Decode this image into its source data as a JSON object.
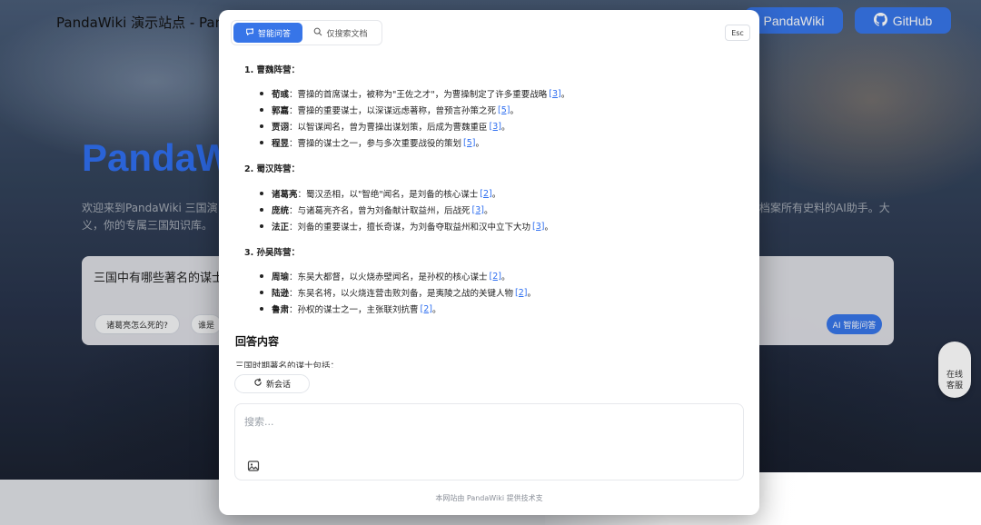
{
  "background": {
    "site_title": "PandaWiki 演示站点 - Pan",
    "buttons": {
      "pandawiki": "PandaWiki",
      "github": "GitHub"
    },
    "hero_title": "PandaW",
    "desc_left": "欢迎来到PandaWiki 三国演义，你的专属三国知识库。",
    "desc_right": "档案所有史料的AI助手。大",
    "search_text": "三国中有哪些著名的谋士",
    "chips": [
      "诸葛亮怎么死的?",
      "谁是"
    ],
    "ai_button": "AI 智能问答",
    "online_service": [
      "在线",
      "客服"
    ]
  },
  "modal": {
    "tabs": [
      {
        "label": "智能问答",
        "active": true,
        "icon": "chat-sparkle-icon"
      },
      {
        "label": "仅搜索文档",
        "active": false,
        "icon": "search-icon"
      }
    ],
    "esc_label": "Esc",
    "sections": [
      {
        "heading": "1. 曹魏阵营：",
        "items": [
          {
            "name": "荀彧",
            "text": "：曹操的首席谋士，被称为\"王佐之才\"，为曹操制定了许多重要战略 ",
            "cite": "[3]",
            "end": "。"
          },
          {
            "name": "郭嘉",
            "text": "：曹操的重要谋士，以深谋远虑著称，曾预言孙策之死 ",
            "cite": "[5]",
            "end": "。"
          },
          {
            "name": "贾诩",
            "text": "：以智谋闻名，曾为曹操出谋划策，后成为曹魏重臣 ",
            "cite": "[3]",
            "end": "。"
          },
          {
            "name": "程昱",
            "text": "：曹操的谋士之一，参与多次重要战役的策划 ",
            "cite": "[5]",
            "end": "。"
          }
        ]
      },
      {
        "heading": "2. 蜀汉阵营：",
        "items": [
          {
            "name": "诸葛亮",
            "text": "：蜀汉丞相，以\"智绝\"闻名，是刘备的核心谋士 ",
            "cite": "[2]",
            "end": "。"
          },
          {
            "name": "庞统",
            "text": "：与诸葛亮齐名，曾为刘备献计取益州，后战死 ",
            "cite": "[3]",
            "end": "。"
          },
          {
            "name": "法正",
            "text": "：刘备的重要谋士，擅长奇谋，为刘备夺取益州和汉中立下大功 ",
            "cite": "[3]",
            "end": "。"
          }
        ]
      },
      {
        "heading": "3. 孙吴阵营：",
        "items": [
          {
            "name": "周瑜",
            "text": "：东吴大都督，以火烧赤壁闻名，是孙权的核心谋士 ",
            "cite": "[2]",
            "end": "。"
          },
          {
            "name": "陆逊",
            "text": "：东吴名将，以火烧连营击败刘备，是夷陵之战的关键人物 ",
            "cite": "[2]",
            "end": "。"
          },
          {
            "name": "鲁肃",
            "text": "：孙权的谋士之一，主张联刘抗曹 ",
            "cite": "[2]",
            "end": "。"
          }
        ]
      }
    ],
    "answer_title": "回答内容",
    "answer_text": "三国时期著名的谋士包括：",
    "new_chat_label": "新会话",
    "input_placeholder": "搜索...",
    "input_value": "",
    "footer_note": "本网站由 PandaWiki 提供技术支"
  }
}
